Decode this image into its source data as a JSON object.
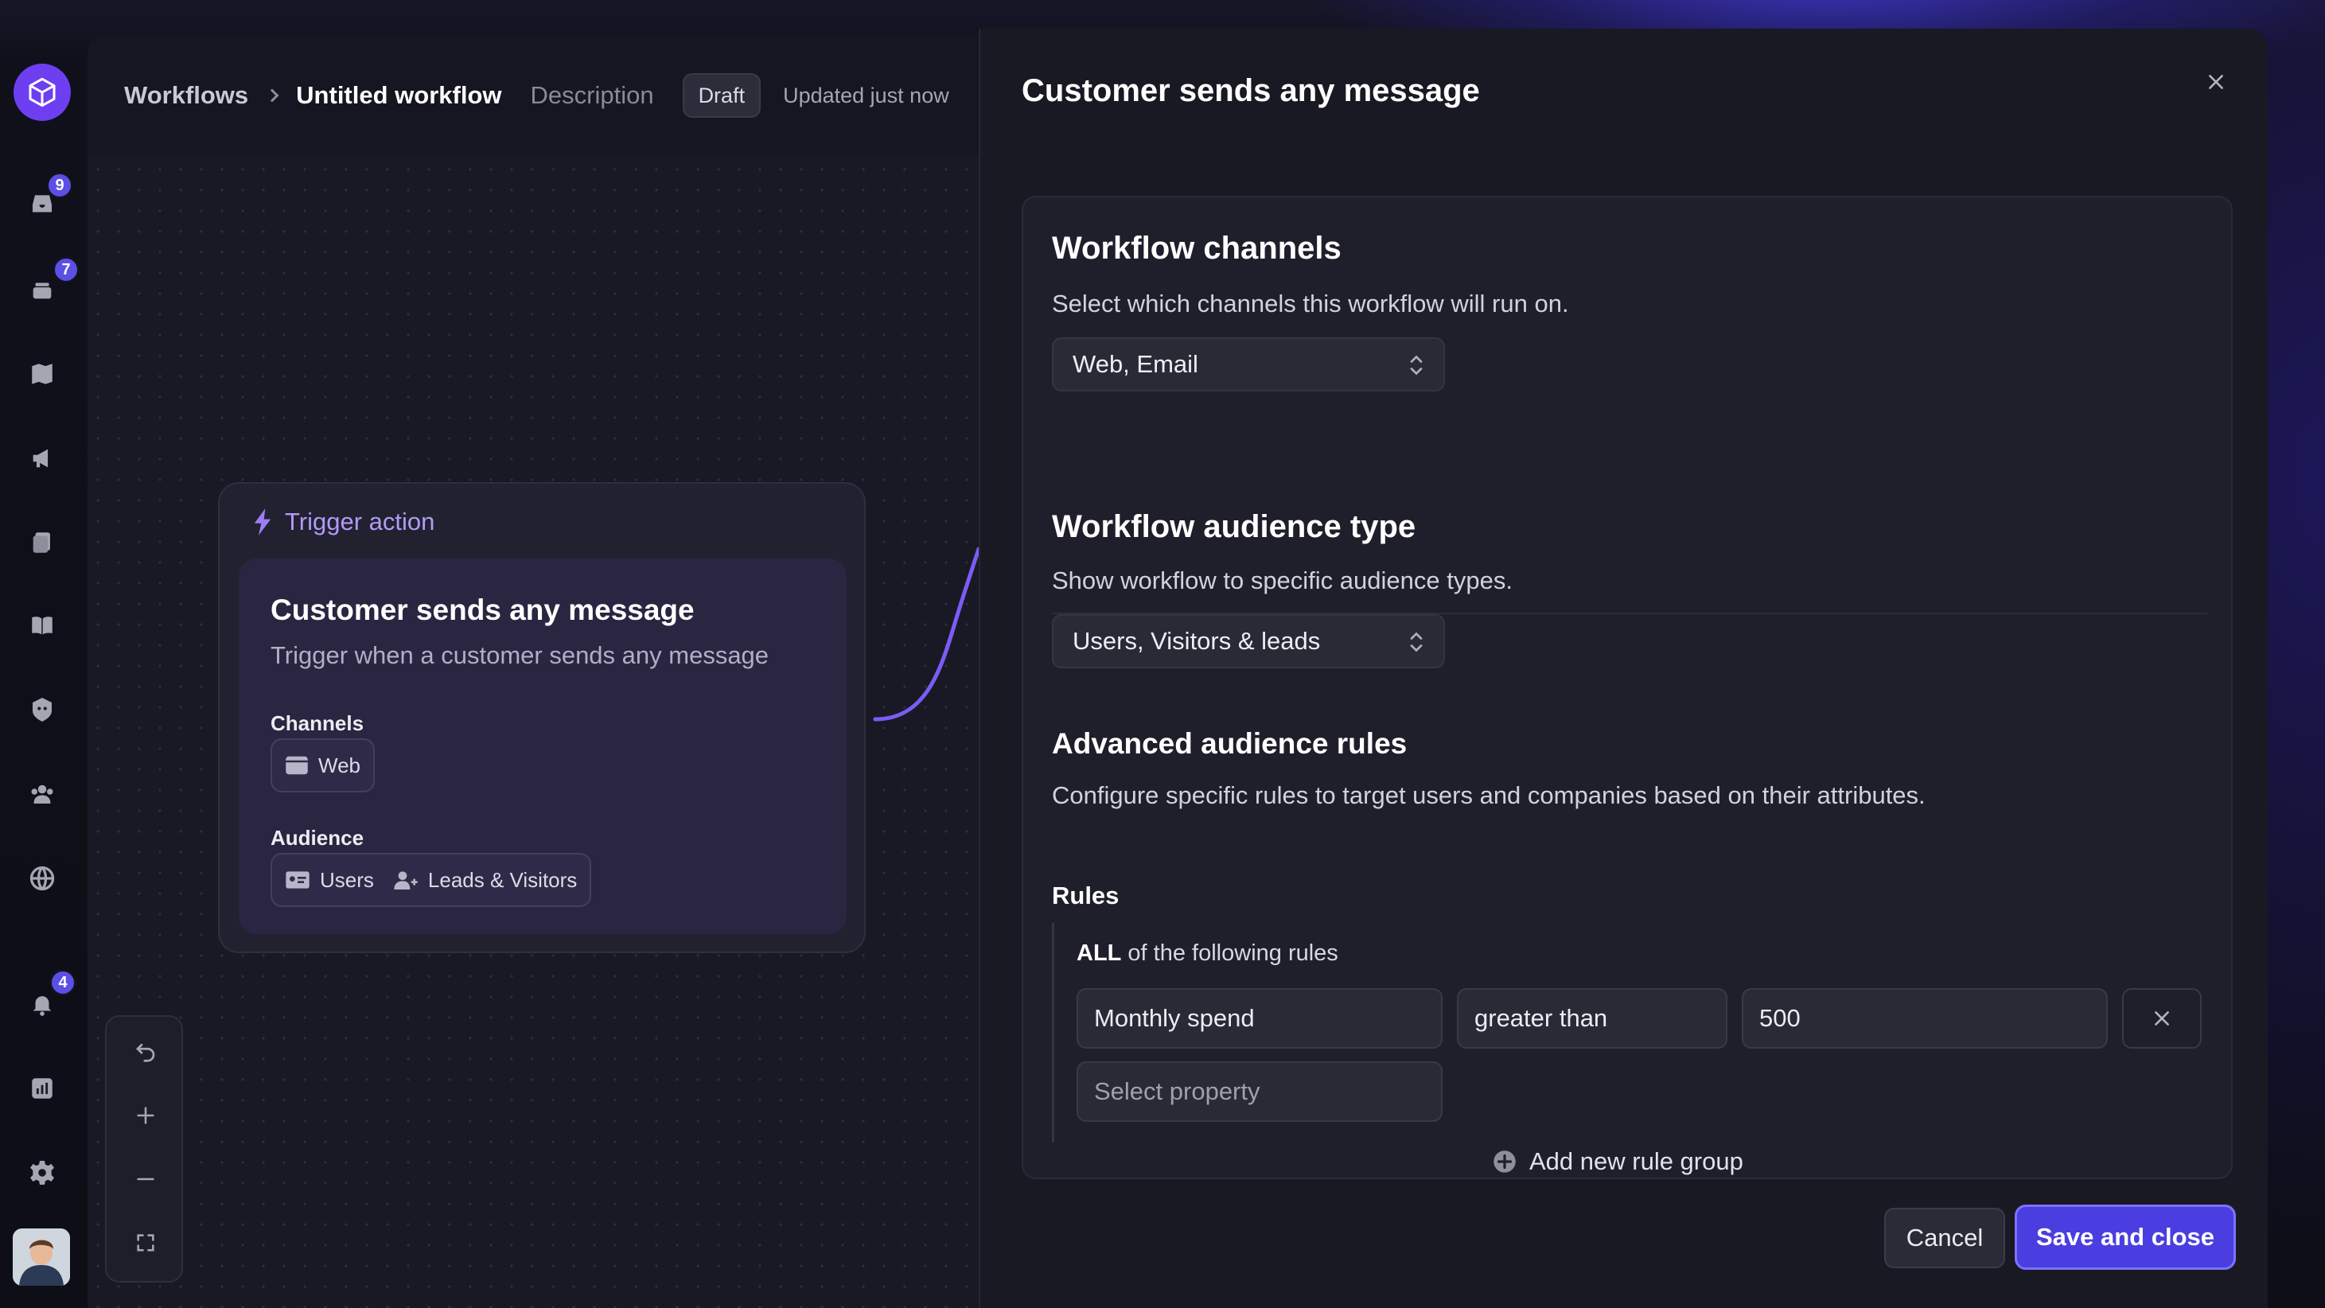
{
  "sidebar": {
    "badges": {
      "inbox": "9",
      "tickets": "7",
      "notifications": "4"
    },
    "icons": [
      "logo-cube-icon",
      "inbox-icon",
      "tickets-icon",
      "map-icon",
      "megaphone-icon",
      "documents-icon",
      "book-icon",
      "bot-icon",
      "contacts-icon",
      "globe-icon",
      "bell-icon",
      "reports-icon",
      "gear-icon"
    ]
  },
  "header": {
    "breadcrumb_root": "Workflows",
    "breadcrumb_current": "Untitled workflow",
    "description": "Description",
    "status": "Draft",
    "updated": "Updated just now"
  },
  "trigger": {
    "heading": "Trigger action",
    "title": "Customer sends any message",
    "subtitle": "Trigger when a customer sends any message",
    "channels_label": "Channels",
    "channels": [
      "Web"
    ],
    "audience_label": "Audience",
    "audience": [
      "Users",
      "Leads & Visitors"
    ]
  },
  "modal": {
    "title": "Customer sends any message",
    "channels": {
      "title": "Workflow channels",
      "subtitle": "Select which channels this workflow will run on.",
      "value": "Web, Email"
    },
    "audience": {
      "title": "Workflow audience type",
      "subtitle": "Show workflow to specific audience types.",
      "value": "Users, Visitors & leads"
    },
    "advanced": {
      "title": "Advanced audience rules",
      "subtitle": "Configure specific rules to target users and companies based on their attributes.",
      "rules_label": "Rules",
      "match_keyword": "ALL",
      "match_text": " of the following rules",
      "rule": {
        "property": "Monthly spend",
        "operator": "greater than",
        "value": "500"
      },
      "new_property_placeholder": "Select property",
      "add_group": "Add new rule group"
    },
    "cancel_label": "Cancel",
    "save_label": "Save and close"
  },
  "colors": {
    "accent": "#4b3ee0",
    "trigger_accent": "#b39af6",
    "badge": "#5b4fe6"
  }
}
